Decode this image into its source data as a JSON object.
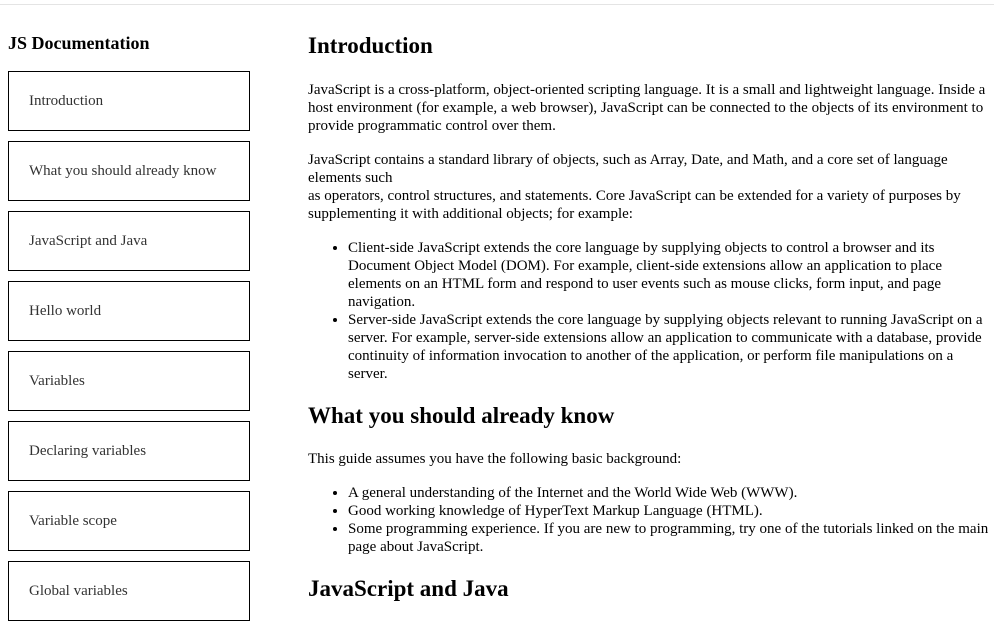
{
  "sidebar": {
    "title": "JS Documentation",
    "items": [
      {
        "label": "Introduction"
      },
      {
        "label": "What you should already know"
      },
      {
        "label": "JavaScript and Java"
      },
      {
        "label": "Hello world"
      },
      {
        "label": "Variables"
      },
      {
        "label": "Declaring variables"
      },
      {
        "label": "Variable scope"
      },
      {
        "label": "Global variables"
      }
    ]
  },
  "main": {
    "intro": {
      "title": "Introduction",
      "p1": "JavaScript is a cross-platform, object-oriented scripting language. It is a small and lightweight language. Inside a host environment (for example, a web browser), JavaScript can be connected to the objects of its environment to provide programmatic control over them.",
      "p2a": "JavaScript contains a standard library of objects, such as Array, Date, and Math, and a core set of language elements such",
      "p2b": "as operators, control structures, and statements. Core JavaScript can be extended for a variety of purposes by supplementing it with additional objects; for example:",
      "list": [
        "Client-side JavaScript extends the core language by supplying objects to control a browser and its Document Object Model (DOM). For example, client-side extensions allow an application to place elements on an HTML form and respond to user events such as mouse clicks, form input, and page navigation.",
        "Server-side JavaScript extends the core language by supplying objects relevant to running JavaScript on a server. For example, server-side extensions allow an application to communicate with a database, provide continuity of information invocation to another of the application, or perform file manipulations on a server."
      ]
    },
    "know": {
      "title": "What you should already know",
      "p1": "This guide assumes you have the following basic background:",
      "list": [
        "A general understanding of the Internet and the World Wide Web (WWW).",
        "Good working knowledge of HyperText Markup Language (HTML).",
        "Some programming experience. If you are new to programming, try one of the tutorials linked on the main page about JavaScript."
      ]
    },
    "java": {
      "title": "JavaScript and Java"
    }
  }
}
